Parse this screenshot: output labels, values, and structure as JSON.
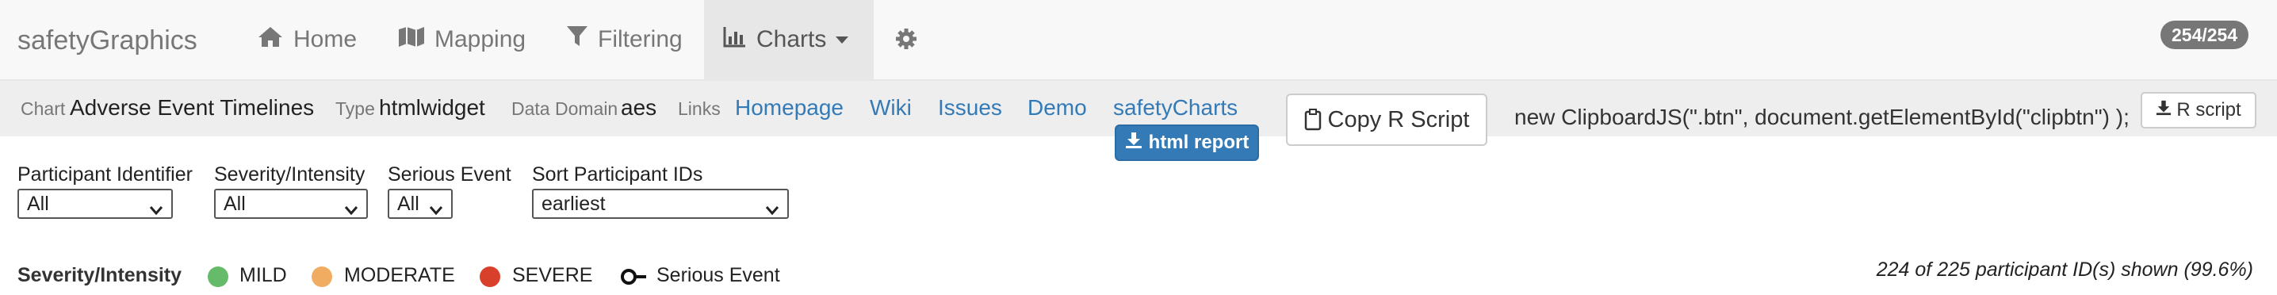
{
  "navbar": {
    "brand": "safetyGraphics",
    "items": [
      {
        "label": "Home",
        "icon": "home-icon"
      },
      {
        "label": "Mapping",
        "icon": "map-icon"
      },
      {
        "label": "Filtering",
        "icon": "filter-icon"
      },
      {
        "label": "Charts",
        "icon": "bar-chart-icon",
        "active": true
      }
    ],
    "settings_icon": "gear-icon",
    "badge": "254/254"
  },
  "infobar": {
    "chart_label": "Chart",
    "chart_value": "Adverse Event Timelines",
    "type_label": "Type",
    "type_value": "htmlwidget",
    "domain_label": "Data Domain",
    "domain_value": "aes",
    "links_label": "Links",
    "links": [
      "Homepage",
      "Wiki",
      "Issues",
      "Demo",
      "safetyCharts"
    ],
    "copy_button": "Copy R Script",
    "code_text": "new ClipboardJS(\".btn\", document.getElementById(\"clipbtn\") );",
    "rscript_button": "R script",
    "html_report_button": "html report"
  },
  "controls": [
    {
      "label": "Participant Identifier",
      "value": "All"
    },
    {
      "label": "Severity/Intensity",
      "value": "All"
    },
    {
      "label": "Serious Event",
      "value": "All"
    },
    {
      "label": "Sort Participant IDs",
      "value": "earliest"
    }
  ],
  "legend": {
    "title": "Severity/Intensity",
    "items": [
      {
        "label": "MILD",
        "color": "#66bb6a"
      },
      {
        "label": "MODERATE",
        "color": "#f0ad62"
      },
      {
        "label": "SEVERE",
        "color": "#d9402b"
      }
    ],
    "serious_label": "Serious Event"
  },
  "status": "224 of 225 participant ID(s) shown (99.6%)"
}
